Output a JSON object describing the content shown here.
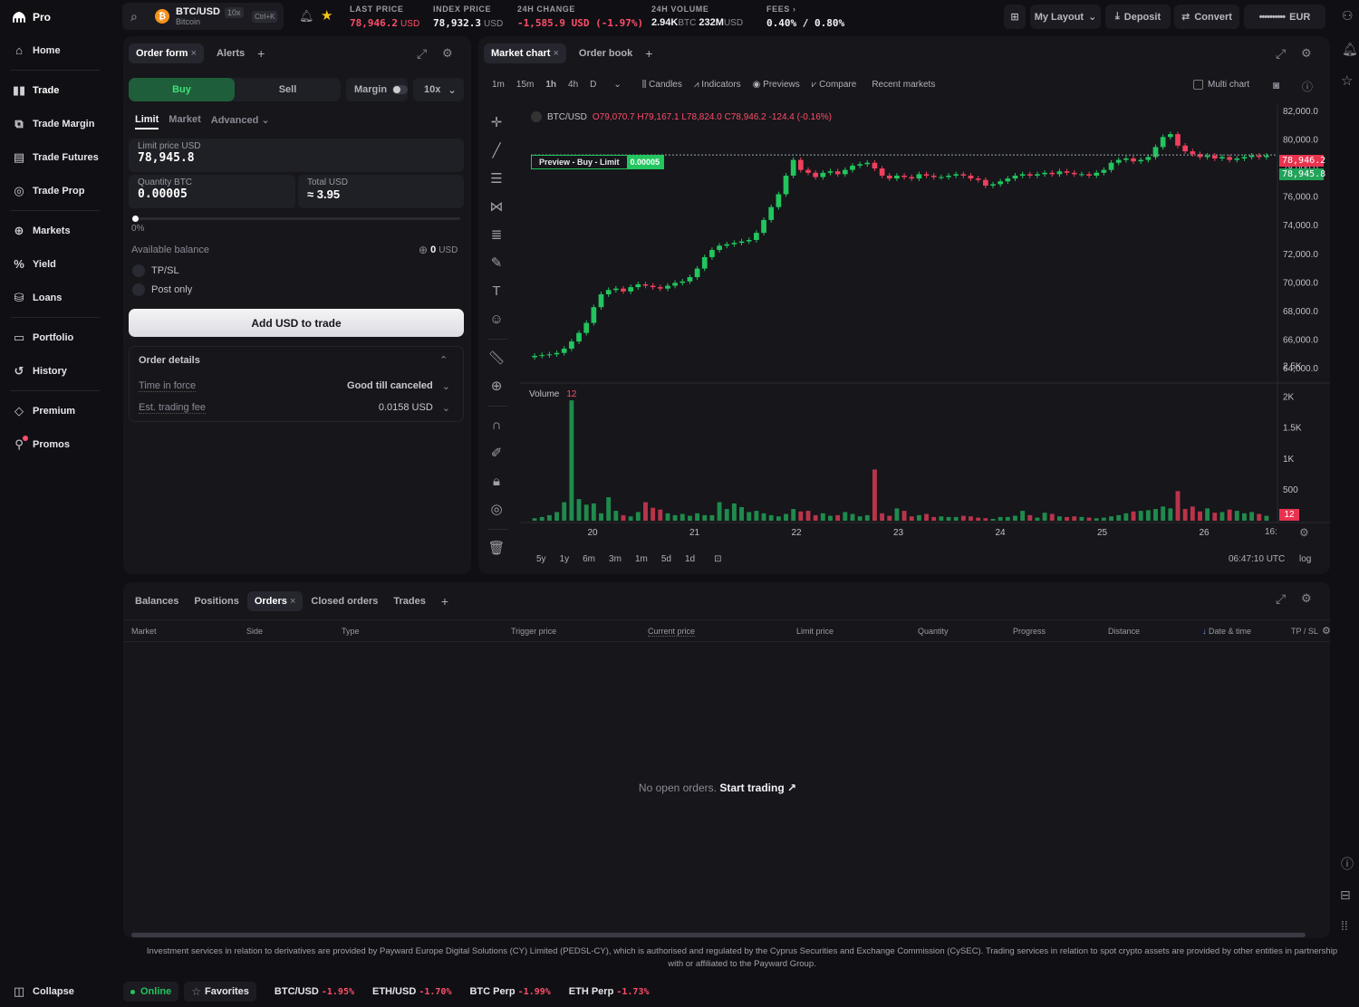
{
  "app": {
    "name": "Pro"
  },
  "sidebar": {
    "items": [
      {
        "label": "Home",
        "icon": "home-icon"
      },
      {
        "label": "Trade",
        "icon": "trade-icon"
      },
      {
        "label": "Trade Margin",
        "icon": "margin-icon"
      },
      {
        "label": "Trade Futures",
        "icon": "futures-icon"
      },
      {
        "label": "Trade Prop",
        "icon": "prop-icon"
      },
      {
        "label": "Markets",
        "icon": "markets-icon"
      },
      {
        "label": "Yield",
        "icon": "percent-icon"
      },
      {
        "label": "Loans",
        "icon": "loans-icon"
      },
      {
        "label": "Portfolio",
        "icon": "portfolio-icon"
      },
      {
        "label": "History",
        "icon": "history-icon"
      },
      {
        "label": "Premium",
        "icon": "diamond-icon"
      },
      {
        "label": "Promos",
        "icon": "gift-icon"
      }
    ],
    "collapse": "Collapse"
  },
  "topbar": {
    "pair": "BTC/USD",
    "leverage": "10x",
    "coin_name": "Bitcoin",
    "shortcut": "Ctrl+K",
    "last_price_label": "LAST PRICE",
    "last_price": "78,946.2",
    "last_price_unit": "USD",
    "index_price_label": "INDEX PRICE",
    "index_price": "78,932.3",
    "index_price_unit": "USD",
    "change_label": "24H CHANGE",
    "change": "-1,585.9 USD (-1.97%)",
    "volume_label": "24H VOLUME",
    "volume_btc": "2.94K",
    "volume_btc_unit": "BTC",
    "volume_usd": "232M",
    "volume_usd_unit": "USD",
    "fees_label": "FEES",
    "fees": "0.40% / 0.80%",
    "my_layout": "My Layout",
    "deposit": "Deposit",
    "convert": "Convert",
    "balance_mask": "••••••••••",
    "currency": "EUR"
  },
  "order_form": {
    "tab_order_form": "Order form",
    "tab_alerts": "Alerts",
    "buy": "Buy",
    "sell": "Sell",
    "margin": "Margin",
    "leverage": "10x",
    "type_limit": "Limit",
    "type_market": "Market",
    "type_advanced": "Advanced",
    "limit_price_label": "Limit price USD",
    "limit_price": "78,945.8",
    "quantity_label": "Quantity BTC",
    "quantity": "0.00005",
    "total_label": "Total USD",
    "total": "≈  3.95",
    "slider_pct": "0%",
    "slider_value": 0,
    "available_balance_label": "Available balance",
    "available_balance": "0",
    "available_balance_unit": "USD",
    "tpsl": "TP/SL",
    "post_only": "Post only",
    "add_usd": "Add USD to trade",
    "details_title": "Order details",
    "time_in_force_label": "Time in force",
    "time_in_force": "Good till canceled",
    "fee_label": "Est. trading fee",
    "fee": "0.0158 USD"
  },
  "chart_panel": {
    "tab_market_chart": "Market chart",
    "tab_order_book": "Order book",
    "timeframes": [
      "1m",
      "15m",
      "1h",
      "4h",
      "D"
    ],
    "active_timeframe": "1h",
    "candles": "Candles",
    "indicators": "Indicators",
    "previews": "Previews",
    "compare": "Compare",
    "recent_markets": "Recent markets",
    "multi_chart": "Multi chart",
    "ohlc_symbol": "BTC/USD",
    "ohlc": "O79,070.7  H79,167.1  L78,824.0  C78,946.2  -124.4 (-0.16%)",
    "preview_label": "Preview - Buy - Limit",
    "preview_qty": "0.00005",
    "price_last": "78,946.2",
    "price_limit": "78,945.8",
    "volume_label": "Volume",
    "volume_value": "12",
    "ranges": [
      "5y",
      "1y",
      "6m",
      "3m",
      "1m",
      "5d",
      "1d"
    ],
    "time_utc": "06:47:10 UTC",
    "log": "log",
    "x_end_label": "16:"
  },
  "chart_data": {
    "type": "candlestick",
    "y_ticks": [
      "82,000.0",
      "80,000.0",
      "78,000.0",
      "76,000.0",
      "74,000.0",
      "72,000.0",
      "70,000.0",
      "68,000.0",
      "66,000.0",
      "64,000.0",
      "2.5K"
    ],
    "ylim": [
      63500,
      82500
    ],
    "x_ticks": [
      "20",
      "21",
      "22",
      "23",
      "24",
      "25",
      "26"
    ],
    "volume_ticks": [
      "2K",
      "1.5K",
      "1K",
      "500"
    ],
    "volume_ylim": [
      0,
      2200
    ],
    "close_series": [
      64900,
      64950,
      65000,
      65100,
      65400,
      65900,
      66500,
      67200,
      68300,
      69200,
      69500,
      69600,
      69400,
      69700,
      69900,
      69800,
      69700,
      69600,
      69800,
      70000,
      70100,
      70400,
      71000,
      71800,
      72300,
      72600,
      72700,
      72800,
      72900,
      73000,
      73500,
      74400,
      75300,
      76200,
      77500,
      78600,
      77900,
      77700,
      77400,
      77700,
      77800,
      77600,
      77900,
      78200,
      78300,
      78400,
      78000,
      77500,
      77300,
      77500,
      77400,
      77300,
      77600,
      77500,
      77400,
      77400,
      77500,
      77600,
      77500,
      77300,
      77200,
      76800,
      76900,
      77100,
      77300,
      77500,
      77600,
      77500,
      77600,
      77700,
      77600,
      77800,
      77700,
      77600,
      77600,
      77500,
      77700,
      77900,
      78400,
      78600,
      78700,
      78500,
      78600,
      78800,
      79500,
      80200,
      80400,
      79600,
      79200,
      79000,
      78800,
      78900,
      78700,
      78800,
      78600,
      78700,
      78800,
      78900,
      78800,
      78900
    ],
    "volume_series": [
      40,
      60,
      90,
      140,
      300,
      1950,
      350,
      260,
      280,
      120,
      380,
      160,
      90,
      70,
      140,
      300,
      210,
      180,
      120,
      90,
      110,
      80,
      120,
      90,
      90,
      300,
      190,
      280,
      220,
      140,
      160,
      120,
      90,
      70,
      110,
      190,
      150,
      160,
      90,
      120,
      80,
      90,
      140,
      110,
      70,
      90,
      830,
      120,
      80,
      200,
      160,
      70,
      90,
      110,
      60,
      70,
      60,
      60,
      80,
      70,
      50,
      40,
      30,
      60,
      60,
      80,
      160,
      90,
      50,
      130,
      110,
      70,
      60,
      70,
      60,
      50,
      40,
      50,
      70,
      90,
      120,
      150,
      160,
      170,
      190,
      230,
      200,
      480,
      190,
      230,
      150,
      200,
      130,
      140,
      180,
      160,
      120,
      140,
      110,
      80
    ]
  },
  "orders_panel": {
    "tabs": [
      "Balances",
      "Positions",
      "Orders",
      "Closed orders",
      "Trades"
    ],
    "active_tab": "Orders",
    "columns": [
      "Market",
      "Side",
      "Type",
      "Trigger price",
      "Current price",
      "Limit price",
      "Quantity",
      "Progress",
      "Distance",
      "Date & time",
      "TP / SL"
    ],
    "empty_text": "No open orders.",
    "start_trading": "Start trading"
  },
  "disclaimer": "Investment services in relation to derivatives are provided by Payward Europe Digital Solutions (CY) Limited (PEDSL-CY), which is authorised and regulated by the Cyprus Securities and Exchange Commission (CySEC). Trading services in relation to spot crypto assets are provided by other entities in partnership with or affiliated to the Payward Group.",
  "footer": {
    "online": "Online",
    "favorites": "Favorites",
    "tickers": [
      {
        "name": "BTC/USD",
        "change": "-1.95%"
      },
      {
        "name": "ETH/USD",
        "change": "-1.70%"
      },
      {
        "name": "BTC Perp",
        "change": "-1.99%"
      },
      {
        "name": "ETH Perp",
        "change": "-1.73%"
      }
    ]
  },
  "colors": {
    "accent_green": "#22c55e",
    "accent_red": "#ff4d6a",
    "buy_bg": "#1f5e3a",
    "background": "#101014",
    "panel": "#16161b"
  }
}
